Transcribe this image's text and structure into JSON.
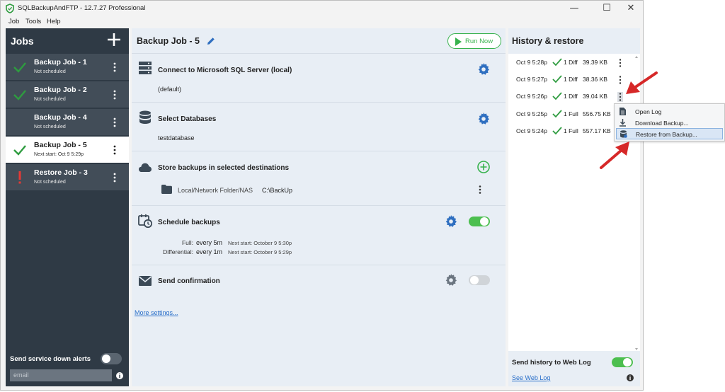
{
  "window": {
    "title": "SQLBackupAndFTP - 12.7.27 Professional",
    "controls": {
      "minimize": "—",
      "maximize": "☐",
      "close": "✕"
    }
  },
  "menu": [
    "Job",
    "Tools",
    "Help"
  ],
  "sidebar": {
    "title": "Jobs",
    "jobs": [
      {
        "name": "Backup Job - 1",
        "status": "Not scheduled",
        "icon": "check-icon"
      },
      {
        "name": "Backup Job - 2",
        "status": "Not scheduled",
        "icon": "check-icon"
      },
      {
        "name": "Backup Job - 4",
        "status": "Not scheduled",
        "icon": "none"
      },
      {
        "name": "Backup Job - 5",
        "status": "Next start: Oct 9 5:29p",
        "icon": "check-icon",
        "active": true
      },
      {
        "name": "Restore Job - 3",
        "status": "Not scheduled",
        "icon": "exclamation-icon"
      }
    ],
    "alerts_label": "Send service down alerts",
    "email_placeholder": "email"
  },
  "job": {
    "title": "Backup Job - 5",
    "run_now": "Run Now",
    "sections": {
      "connect": {
        "title": "Connect to Microsoft SQL Server (local)",
        "value": "(default)"
      },
      "databases": {
        "title": "Select Databases",
        "value": "testdatabase"
      },
      "destinations": {
        "title": "Store backups in selected destinations",
        "dest_type": "Local/Network Folder/NAS",
        "dest_path": "C:\\BackUp"
      },
      "schedule": {
        "title": "Schedule backups",
        "full_label": "Full:",
        "full_value": "every 5m",
        "full_next": "Next start: October 9 5:30p",
        "diff_label": "Differential:",
        "diff_value": "every 1m",
        "diff_next": "Next start: October 9 5:29p"
      },
      "confirmation": {
        "title": "Send confirmation"
      }
    },
    "more_settings": "More settings..."
  },
  "history": {
    "title": "History & restore",
    "items": [
      {
        "time": "Oct 9 5:28p",
        "kind": "1 Diff",
        "size": "39.39 KB"
      },
      {
        "time": "Oct 9 5:27p",
        "kind": "1 Diff",
        "size": "38.36 KB"
      },
      {
        "time": "Oct 9 5:26p",
        "kind": "1 Diff",
        "size": "39.04 KB"
      },
      {
        "time": "Oct 9 5:25p",
        "kind": "1 Full",
        "size": "556.75 KB"
      },
      {
        "time": "Oct 9 5:24p",
        "kind": "1 Full",
        "size": "557.17 KB"
      }
    ],
    "send_label": "Send history to Web Log",
    "web_log_link": "See Web Log"
  },
  "context_menu": {
    "items": [
      "Open Log",
      "Download Backup...",
      "Restore from Backup..."
    ]
  },
  "colors": {
    "accent_blue": "#2f6fc0",
    "green": "#37b24d",
    "sidebar": "#2f3a45",
    "alert_red": "#e53935"
  }
}
